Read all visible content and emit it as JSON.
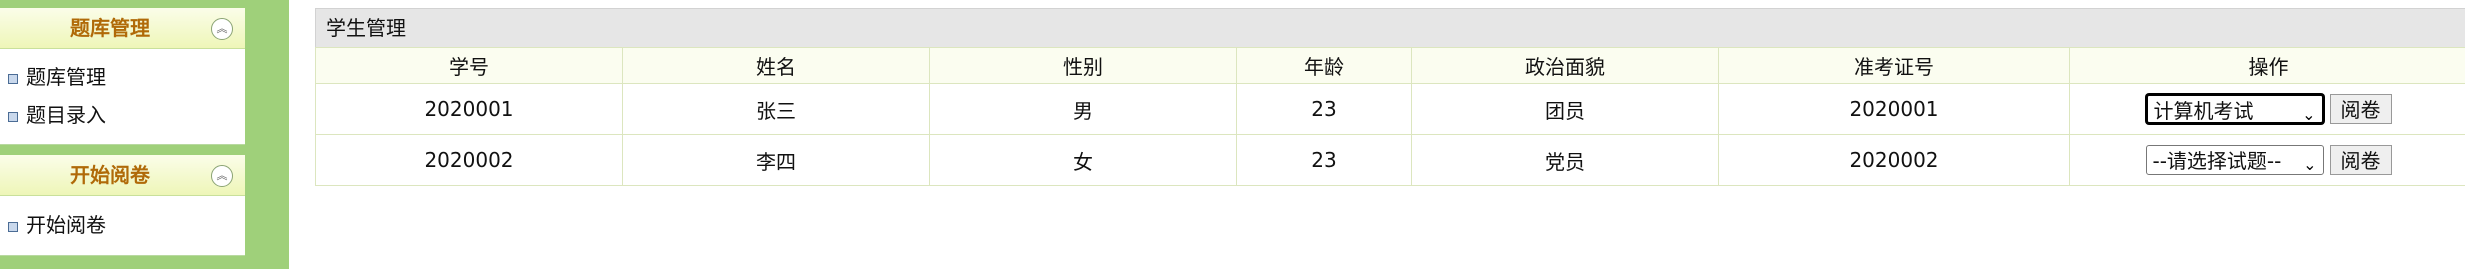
{
  "sidebar": {
    "panels": [
      {
        "title": "题库管理",
        "items": [
          "题库管理",
          "题目录入"
        ]
      },
      {
        "title": "开始阅卷",
        "items": [
          "开始阅卷"
        ]
      }
    ]
  },
  "main": {
    "section_title": "学生管理",
    "columns": [
      "学号",
      "姓名",
      "性别",
      "年龄",
      "政治面貌",
      "准考证号",
      "操作"
    ],
    "rows": [
      {
        "id": "2020001",
        "name": "张三",
        "gender": "男",
        "age": "23",
        "political": "团员",
        "exam_no": "2020001",
        "select_value": "计算机考试",
        "button": "阅卷"
      },
      {
        "id": "2020002",
        "name": "李四",
        "gender": "女",
        "age": "23",
        "political": "党员",
        "exam_no": "2020002",
        "select_value": "--请选择试题--",
        "button": "阅卷"
      }
    ]
  }
}
